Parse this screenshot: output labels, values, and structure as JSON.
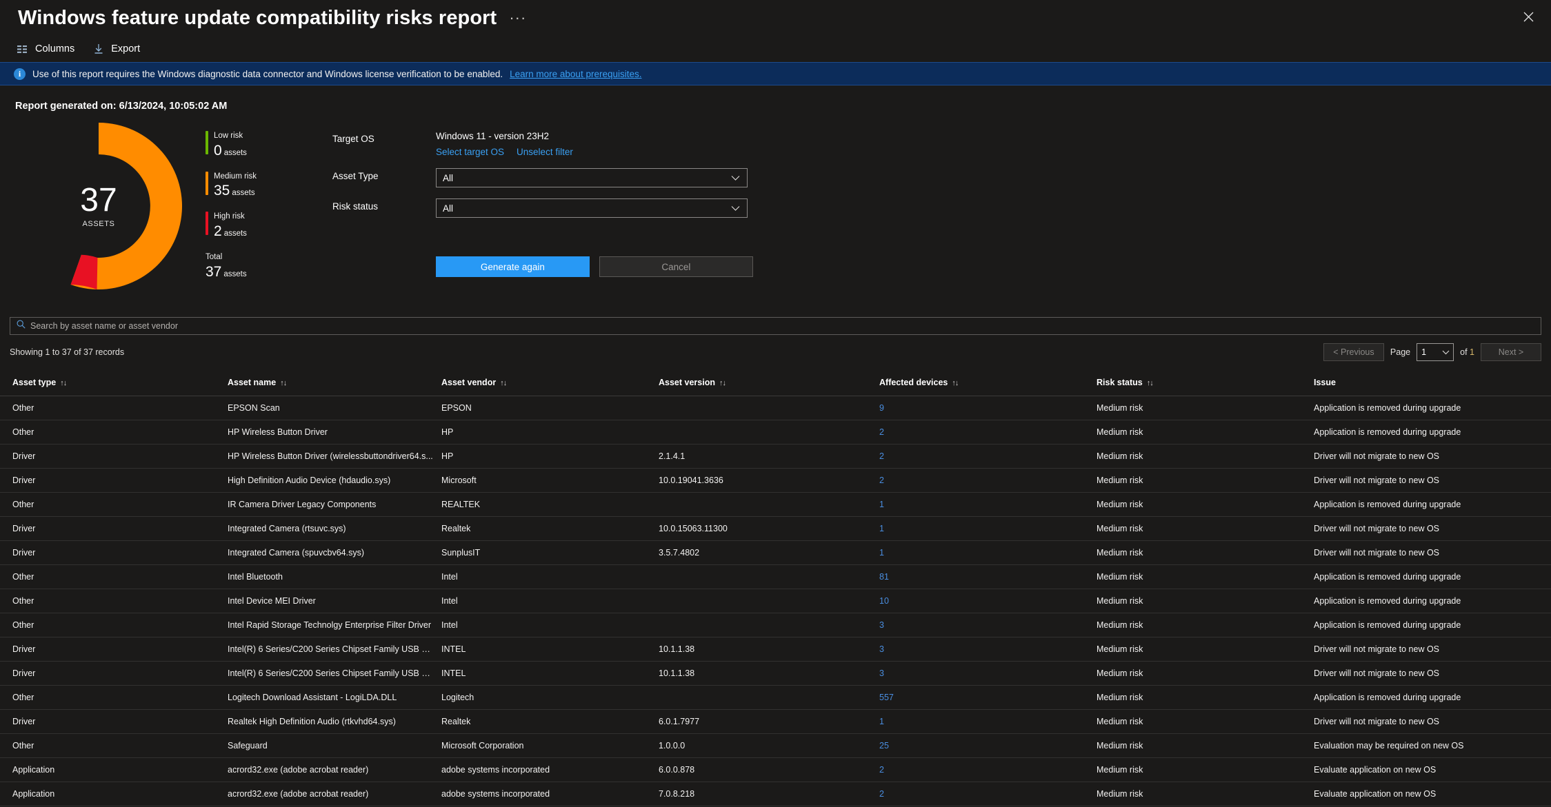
{
  "window": {
    "title": "Windows feature update compatibility risks report",
    "ellipsis": "···",
    "close_icon": "close-icon"
  },
  "toolbar": {
    "columns_label": "Columns",
    "export_label": "Export"
  },
  "banner": {
    "text": "Use of this report requires the Windows diagnostic data connector and Windows license verification to be enabled.",
    "link_text": "Learn more about prerequisites.",
    "bg": "#0c2c5a",
    "link_color": "#3aa0f3"
  },
  "report": {
    "generated_label": "Report generated on: 6/13/2024, 10:05:02 AM"
  },
  "chart_data": {
    "type": "pie",
    "title": "Asset compatibility risk distribution",
    "center_value": "37",
    "center_label": "ASSETS",
    "categories": [
      "Low risk",
      "Medium risk",
      "High risk"
    ],
    "values": [
      0,
      35,
      2
    ],
    "colors": [
      "#6bb700",
      "#ff8c00",
      "#e81123"
    ],
    "total": 37,
    "legend_position": "right",
    "legend": [
      {
        "name": "Low risk",
        "count": "0",
        "unit": "assets",
        "color": "#6bb700"
      },
      {
        "name": "Medium risk",
        "count": "35",
        "unit": "assets",
        "color": "#ff8c00"
      },
      {
        "name": "High risk",
        "count": "2",
        "unit": "assets",
        "color": "#e81123"
      },
      {
        "name": "Total",
        "count": "37",
        "unit": "assets",
        "color": ""
      }
    ]
  },
  "filters": {
    "target_os_label": "Target OS",
    "target_os_value": "Windows 11 - version 23H2",
    "select_target_os": "Select target OS",
    "unselect_filter": "Unselect filter",
    "asset_type_label": "Asset Type",
    "asset_type_value": "All",
    "risk_status_label": "Risk status",
    "risk_status_value": "All",
    "generate_label": "Generate again",
    "cancel_label": "Cancel"
  },
  "search": {
    "placeholder": "Search by asset name or asset vendor",
    "value": "",
    "icon": "search-icon"
  },
  "table": {
    "records_text": "Showing 1 to 37 of 37 records",
    "pager": {
      "previous": "< Previous",
      "page_label": "Page",
      "page_value": "1",
      "of_label": "of",
      "total_pages": "1",
      "next": "Next >"
    },
    "columns": [
      "Asset type",
      "Asset name",
      "Asset vendor",
      "Asset version",
      "Affected devices",
      "Risk status",
      "Issue"
    ],
    "sort_glyph": "↑↓",
    "rows": [
      {
        "type": "Other",
        "name": "EPSON Scan",
        "vendor": "EPSON",
        "version": "",
        "devices": "9",
        "risk": "Medium risk",
        "issue": "Application is removed during upgrade"
      },
      {
        "type": "Other",
        "name": "HP Wireless Button Driver",
        "vendor": "HP",
        "version": "",
        "devices": "2",
        "risk": "Medium risk",
        "issue": "Application is removed during upgrade"
      },
      {
        "type": "Driver",
        "name": "HP Wireless Button Driver (wirelessbuttondriver64.s...",
        "vendor": "HP",
        "version": "2.1.4.1",
        "devices": "2",
        "risk": "Medium risk",
        "issue": "Driver will not migrate to new OS"
      },
      {
        "type": "Driver",
        "name": "High Definition Audio Device (hdaudio.sys)",
        "vendor": "Microsoft",
        "version": "10.0.19041.3636",
        "devices": "2",
        "risk": "Medium risk",
        "issue": "Driver will not migrate to new OS"
      },
      {
        "type": "Other",
        "name": "IR Camera Driver Legacy Components",
        "vendor": "REALTEK",
        "version": "",
        "devices": "1",
        "risk": "Medium risk",
        "issue": "Application is removed during upgrade"
      },
      {
        "type": "Driver",
        "name": "Integrated Camera (rtsuvc.sys)",
        "vendor": "Realtek",
        "version": "10.0.15063.11300",
        "devices": "1",
        "risk": "Medium risk",
        "issue": "Driver will not migrate to new OS"
      },
      {
        "type": "Driver",
        "name": "Integrated Camera (spuvcbv64.sys)",
        "vendor": "SunplusIT",
        "version": "3.5.7.4802",
        "devices": "1",
        "risk": "Medium risk",
        "issue": "Driver will not migrate to new OS"
      },
      {
        "type": "Other",
        "name": "Intel Bluetooth",
        "vendor": "Intel",
        "version": "",
        "devices": "81",
        "risk": "Medium risk",
        "issue": "Application is removed during upgrade"
      },
      {
        "type": "Other",
        "name": "Intel Device MEI Driver",
        "vendor": "Intel",
        "version": "",
        "devices": "10",
        "risk": "Medium risk",
        "issue": "Application is removed during upgrade"
      },
      {
        "type": "Other",
        "name": "Intel Rapid Storage Technolgy Enterprise Filter Driver",
        "vendor": "Intel",
        "version": "",
        "devices": "3",
        "risk": "Medium risk",
        "issue": "Application is removed during upgrade"
      },
      {
        "type": "Driver",
        "name": "Intel(R) 6 Series/C200 Series Chipset Family USB En...",
        "vendor": "INTEL",
        "version": "10.1.1.38",
        "devices": "3",
        "risk": "Medium risk",
        "issue": "Driver will not migrate to new OS"
      },
      {
        "type": "Driver",
        "name": "Intel(R) 6 Series/C200 Series Chipset Family USB En...",
        "vendor": "INTEL",
        "version": "10.1.1.38",
        "devices": "3",
        "risk": "Medium risk",
        "issue": "Driver will not migrate to new OS"
      },
      {
        "type": "Other",
        "name": "Logitech Download Assistant - LogiLDA.DLL",
        "vendor": "Logitech",
        "version": "",
        "devices": "557",
        "risk": "Medium risk",
        "issue": "Application is removed during upgrade"
      },
      {
        "type": "Driver",
        "name": "Realtek High Definition Audio (rtkvhd64.sys)",
        "vendor": "Realtek",
        "version": "6.0.1.7977",
        "devices": "1",
        "risk": "Medium risk",
        "issue": "Driver will not migrate to new OS"
      },
      {
        "type": "Other",
        "name": "Safeguard",
        "vendor": "Microsoft Corporation",
        "version": "1.0.0.0",
        "devices": "25",
        "risk": "Medium risk",
        "issue": "Evaluation may be required on new OS"
      },
      {
        "type": "Application",
        "name": "acrord32.exe (adobe acrobat reader)",
        "vendor": "adobe systems incorporated",
        "version": "6.0.0.878",
        "devices": "2",
        "risk": "Medium risk",
        "issue": "Evaluate application on new OS"
      },
      {
        "type": "Application",
        "name": "acrord32.exe (adobe acrobat reader)",
        "vendor": "adobe systems incorporated",
        "version": "7.0.8.218",
        "devices": "2",
        "risk": "Medium risk",
        "issue": "Evaluate application on new OS"
      }
    ]
  }
}
